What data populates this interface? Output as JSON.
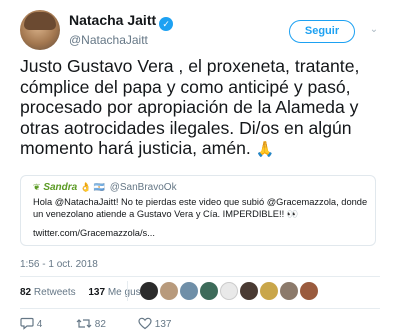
{
  "author": {
    "display_name": "Natacha Jaitt",
    "handle": "@NatachaJaitt",
    "verified_glyph": "✓"
  },
  "follow_button": {
    "label": "Seguir",
    "caret": "⌄"
  },
  "tweet": {
    "text": "Justo Gustavo Vera , el proxeneta, tratante, cómplice del papa y como anticipé y pasó, procesado por apropiación de la Alameda y otras aotrocidades ilegales. Di/os en algún momento hará justicia, amén.",
    "emoji": "🙏"
  },
  "quoted_tweet": {
    "name": "Sandra",
    "name_emojis": "👌 🇦🇷",
    "handle": "@SanBravoOk",
    "text": "Hola @NatachaJaitt! No te pierdas este video que subió @Gracemazzola, donde un venezolano atiende a Gustavo Vera y Cía. IMPERDIBLE!! 👀",
    "link": "twitter.com/Gracemazzola/s..."
  },
  "timestamp": "1:56 - 1 oct. 2018",
  "stats": {
    "retweets_count": "82",
    "retweets_label": "Retweets",
    "likes_count": "137",
    "likes_label": "Me gusta"
  },
  "actions": {
    "reply_count": "4",
    "retweet_count": "82",
    "like_count": "137"
  },
  "colors": {
    "accent": "#1da1f2",
    "muted": "#657786",
    "text": "#14171a",
    "border": "#e1e8ed",
    "quote_name": "#5a9a23"
  }
}
